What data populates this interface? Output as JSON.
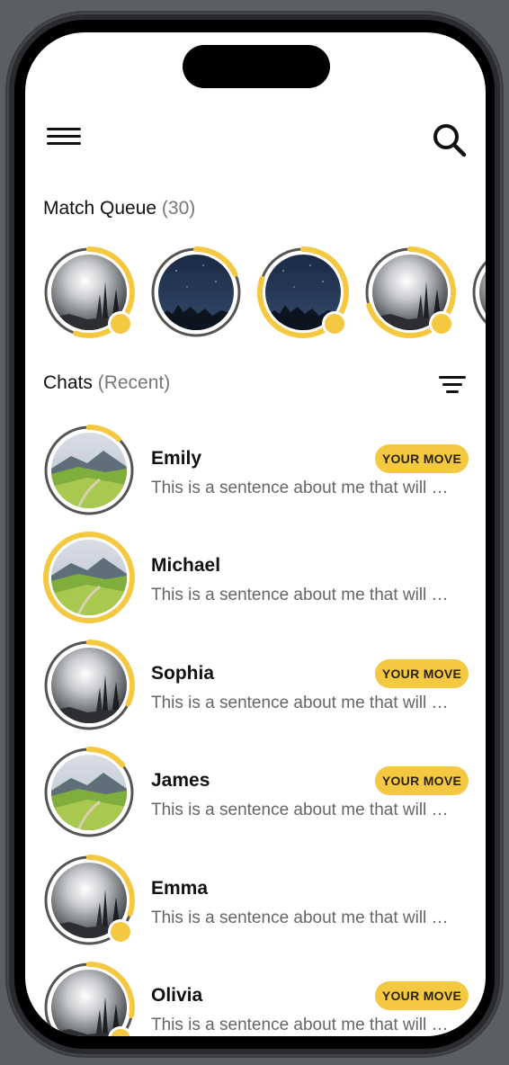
{
  "header": {
    "menu_icon": "hamburger-menu-icon",
    "search_icon": "search-icon"
  },
  "match_queue": {
    "title": "Match Queue",
    "count": "(30)",
    "items": [
      {
        "image": "foggy-forest",
        "progress": 0.55,
        "has_dot": true
      },
      {
        "image": "night-sky",
        "progress": 0.18,
        "has_dot": false
      },
      {
        "image": "night-sky",
        "progress": 0.8,
        "has_dot": true
      },
      {
        "image": "foggy-forest",
        "progress": 0.7,
        "has_dot": true
      },
      {
        "image": "foggy-forest",
        "progress": 0.3,
        "has_dot": false
      }
    ]
  },
  "chats": {
    "title": "Chats",
    "subtitle": "(Recent)",
    "filter_icon": "filter-icon",
    "items": [
      {
        "name": "Emily",
        "preview": "This is a sentence about me that will show up here",
        "badge": "YOUR MOVE",
        "image": "green-valley",
        "progress": 0.12,
        "has_dot": false
      },
      {
        "name": "Michael",
        "preview": "This is a sentence about me that will show up here",
        "badge": "",
        "image": "green-valley",
        "progress": 1.0,
        "has_dot": false
      },
      {
        "name": "Sophia",
        "preview": "This is a sentence about me that will show up here",
        "badge": "YOUR MOVE",
        "image": "foggy-forest",
        "progress": 0.32,
        "has_dot": false
      },
      {
        "name": "James",
        "preview": "This is a sentence about me that will show up here",
        "badge": "YOUR MOVE",
        "image": "green-valley",
        "progress": 0.14,
        "has_dot": false
      },
      {
        "name": "Emma",
        "preview": "This is a sentence about me that will show up here",
        "badge": "",
        "image": "foggy-forest",
        "progress": 0.3,
        "has_dot": true
      },
      {
        "name": "Olivia",
        "preview": "This is a sentence about me that will show up here",
        "badge": "YOUR MOVE",
        "image": "foggy-forest",
        "progress": 0.28,
        "has_dot": true
      }
    ]
  },
  "colors": {
    "accent": "#f5c842",
    "ring_track": "#555555"
  }
}
